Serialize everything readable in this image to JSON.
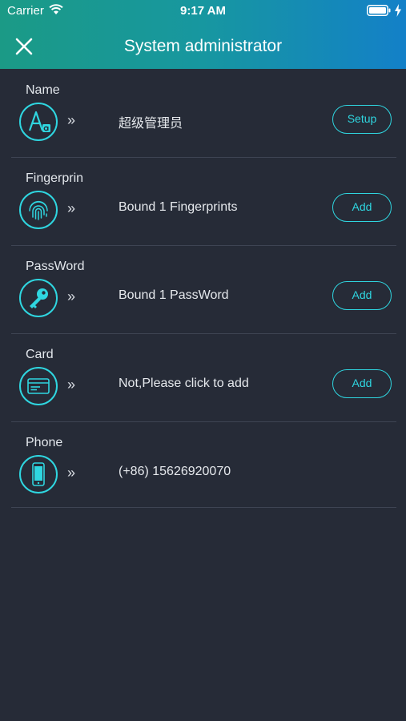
{
  "status_bar": {
    "carrier": "Carrier",
    "time": "9:17 AM"
  },
  "header": {
    "title": "System administrator",
    "close_icon": "close-icon"
  },
  "colors": {
    "accent": "#2fd6e0",
    "background": "#262b37",
    "header_start": "#1b9a86",
    "header_end": "#1380c8"
  },
  "rows": [
    {
      "label": "Name",
      "icon": "font-icon",
      "chevrons": "»",
      "value": "超级管理员",
      "action": "Setup"
    },
    {
      "label": "Fingerprin",
      "icon": "fingerprint-icon",
      "chevrons": "»",
      "value": "Bound 1 Fingerprints",
      "action": "Add"
    },
    {
      "label": "PassWord",
      "icon": "key-icon",
      "chevrons": "»",
      "value": "Bound 1 PassWord",
      "action": "Add"
    },
    {
      "label": "Card",
      "icon": "card-icon",
      "chevrons": "»",
      "value": "Not,Please click to add",
      "action": "Add"
    },
    {
      "label": "Phone",
      "icon": "phone-icon",
      "chevrons": "»",
      "value": "(+86) 15626920070"
    }
  ]
}
